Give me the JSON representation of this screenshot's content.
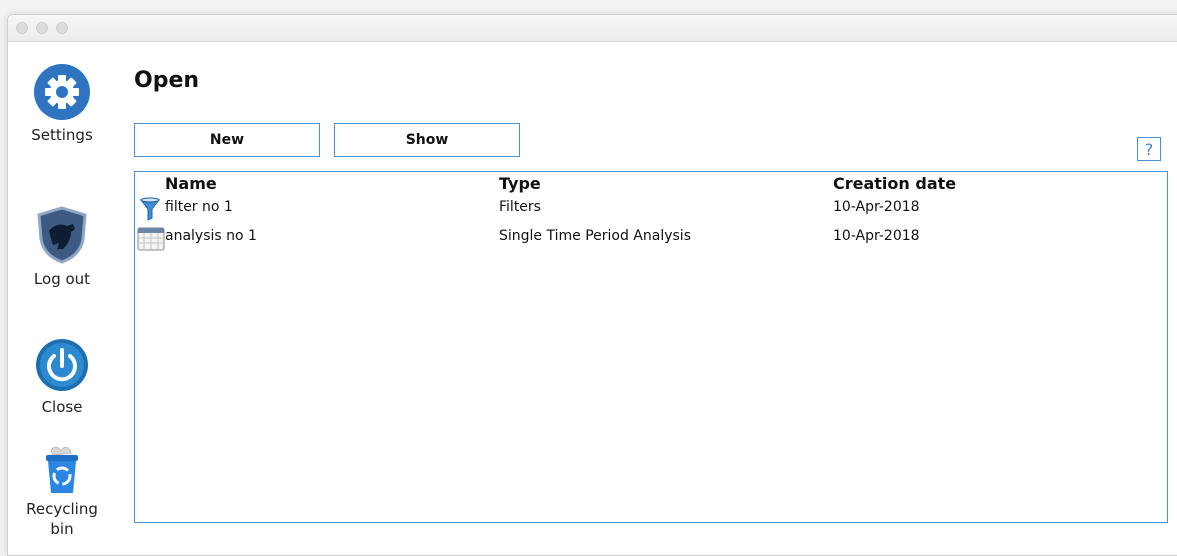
{
  "window": {
    "controls": [
      "close",
      "minimize",
      "zoom"
    ]
  },
  "sidebar": {
    "items": [
      {
        "label": "Settings",
        "icon": "gear-icon"
      },
      {
        "label": "Log out",
        "icon": "shield-panther-icon"
      },
      {
        "label": "Close",
        "icon": "power-icon"
      },
      {
        "label": "Recycling bin",
        "icon": "recycling-bin-icon"
      }
    ]
  },
  "main": {
    "title": "Open",
    "buttons": {
      "new": "New",
      "show": "Show"
    },
    "help": "?"
  },
  "table": {
    "columns": [
      "Name",
      "Type",
      "Creation date"
    ],
    "rows": [
      {
        "icon": "funnel-icon",
        "name": "filter no 1",
        "type": "Filters",
        "date": "10-Apr-2018"
      },
      {
        "icon": "calendar-icon",
        "name": "analysis no 1",
        "type": "Single Time Period Analysis",
        "date": "10-Apr-2018"
      }
    ]
  },
  "colors": {
    "accent": "#4a90d9",
    "icon_blue": "#2f74c0"
  }
}
